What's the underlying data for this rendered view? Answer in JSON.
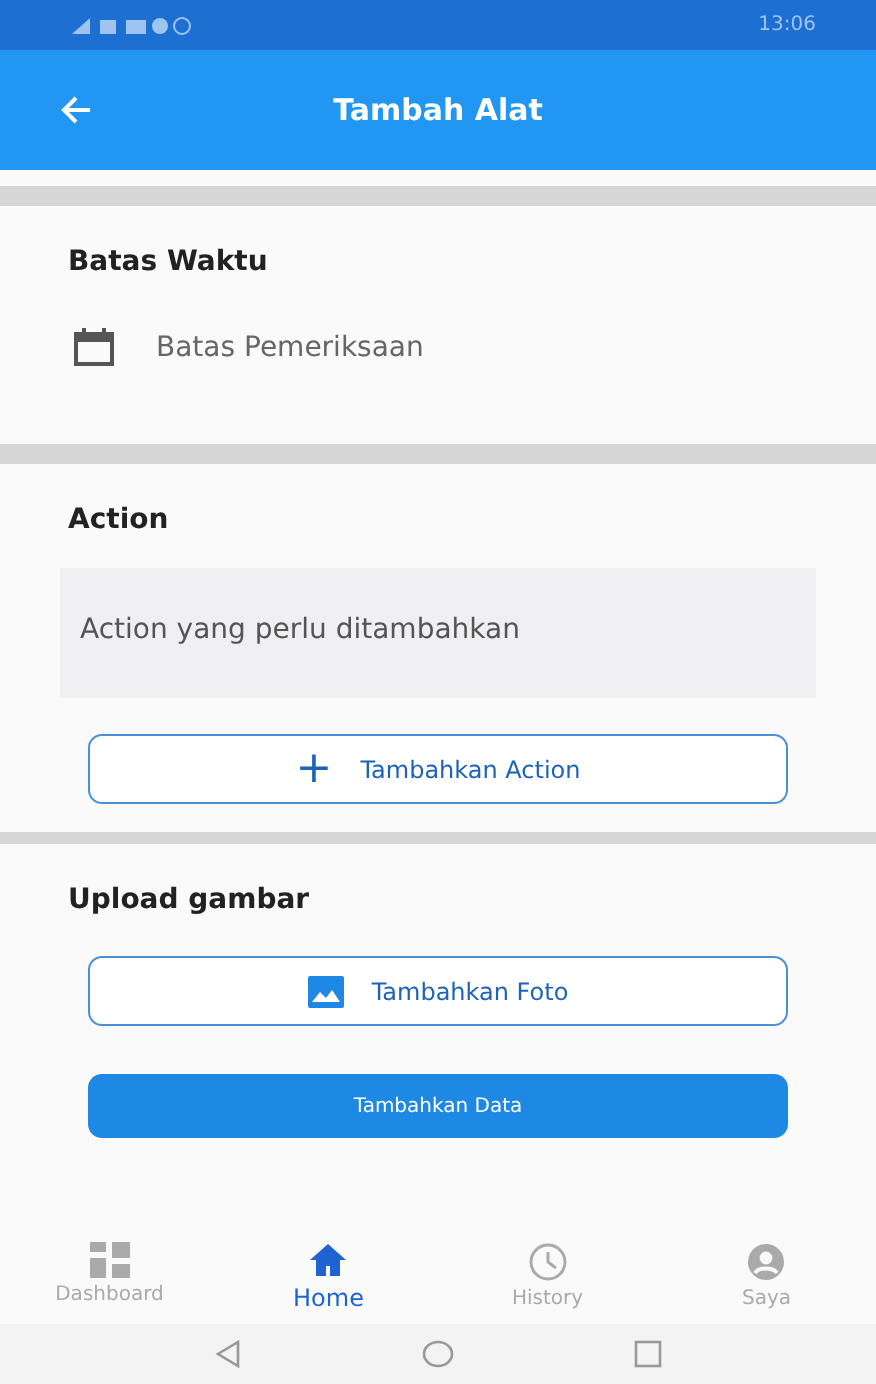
{
  "status_bar": {
    "time": "13:06"
  },
  "app_bar": {
    "title": "Tambah Alat"
  },
  "deadline": {
    "heading": "Batas Waktu",
    "placeholder": "Batas Pemeriksaan"
  },
  "action": {
    "heading": "Action",
    "placeholder": "Action yang perlu ditambahkan",
    "add_button": {
      "icon": "+",
      "label": "Tambahkan Action"
    }
  },
  "upload": {
    "heading": "Upload gambar",
    "photo_button": "Tambahkan Foto"
  },
  "submit_button": "Tambahkan Data",
  "bottom_nav": [
    {
      "kind": "dashboard",
      "label": "Dashboard",
      "selected": false
    },
    {
      "kind": "home",
      "label": "Home",
      "selected": true
    },
    {
      "kind": "history",
      "label": "History",
      "selected": false
    },
    {
      "kind": "profile",
      "label": "Saya",
      "selected": false
    }
  ]
}
